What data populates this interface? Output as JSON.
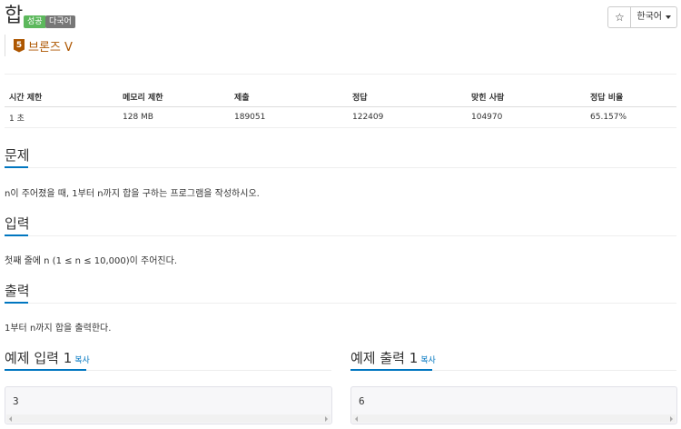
{
  "problem": {
    "title": "합",
    "badges": {
      "success": "성공",
      "multilang": "다국어"
    },
    "tier": {
      "number": "5",
      "label": "브론즈 V"
    }
  },
  "toolbar": {
    "star": "☆",
    "language": "한국어"
  },
  "stats": {
    "headers": [
      "시간 제한",
      "메모리 제한",
      "제출",
      "정답",
      "맞힌 사람",
      "정답 비율"
    ],
    "values": [
      "1 초",
      "128 MB",
      "189051",
      "122409",
      "104970",
      "65.157%"
    ]
  },
  "sections": {
    "description": {
      "title": "문제",
      "text": "n이 주어졌을 때, 1부터 n까지 합을 구하는 프로그램을 작성하시오."
    },
    "input": {
      "title": "입력",
      "text": "첫째 줄에 n (1 ≤ n ≤ 10,000)이 주어진다."
    },
    "output": {
      "title": "출력",
      "text": "1부터 n까지 합을 출력한다."
    }
  },
  "samples": {
    "input": {
      "title": "예제 입력 1",
      "copy": "복사",
      "content": "3"
    },
    "output": {
      "title": "예제 출력 1",
      "copy": "복사",
      "content": "6"
    }
  },
  "colors": {
    "accent": "#0076c0",
    "success": "#5cb85c",
    "bronze": "#ad5600"
  }
}
